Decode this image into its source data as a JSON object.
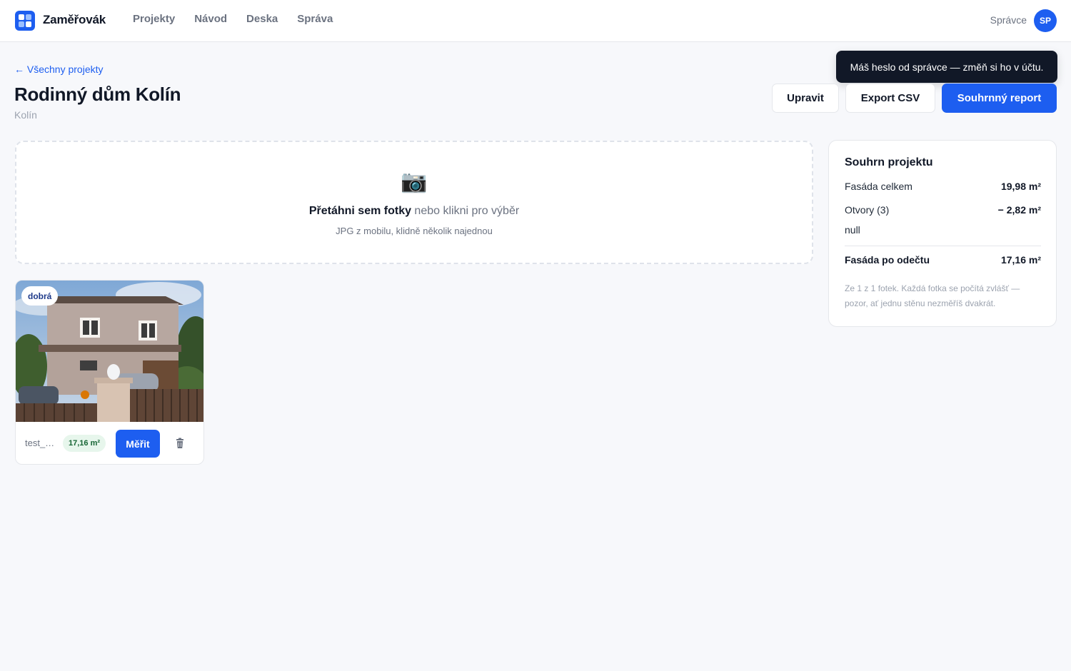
{
  "app": {
    "brand": "Zaměřovák",
    "nav": [
      "Projekty",
      "Návod",
      "Deska",
      "Správa"
    ],
    "user_role": "Správce",
    "user_initials": "SP"
  },
  "toast": {
    "message": "Máš heslo od správce — změň si ho v účtu."
  },
  "header": {
    "back_link": "← Všechny projekty",
    "title": "Rodinný dům Kolín",
    "subtitle": "Kolín",
    "actions": {
      "edit": "Upravit",
      "export": "Export CSV",
      "report": "Souhrnný report"
    }
  },
  "dropzone": {
    "icon": "camera-icon",
    "main_bold": "Přetáhni sem fotky",
    "main_rest": " nebo klikni pro výběr",
    "hint": "JPG z mobilu, klidně několik najednou"
  },
  "photos": [
    {
      "quality": "dobrá",
      "file_name": "test_…",
      "area": "17,16 m²",
      "measure_label": "Měřit"
    }
  ],
  "summary": {
    "title": "Souhrn projektu",
    "facade_total_label": "Fasáda celkem",
    "facade_total_value": "19,98 m²",
    "openings_label": "Otvory (3)",
    "openings_value": "− 2,82 m²",
    "extra_line": "null",
    "net_label": "Fasáda po odečtu",
    "net_value": "17,16 m²",
    "note": "Ze 1 z 1 fotek. Každá fotka se počítá zvlášť — pozor, ať jednu stěnu nezměříš dvakrát."
  },
  "colors": {
    "accent": "#1d5ef0",
    "toast_bg": "#111827",
    "area_badge_bg": "#e7f6ec",
    "area_badge_text": "#166534"
  }
}
